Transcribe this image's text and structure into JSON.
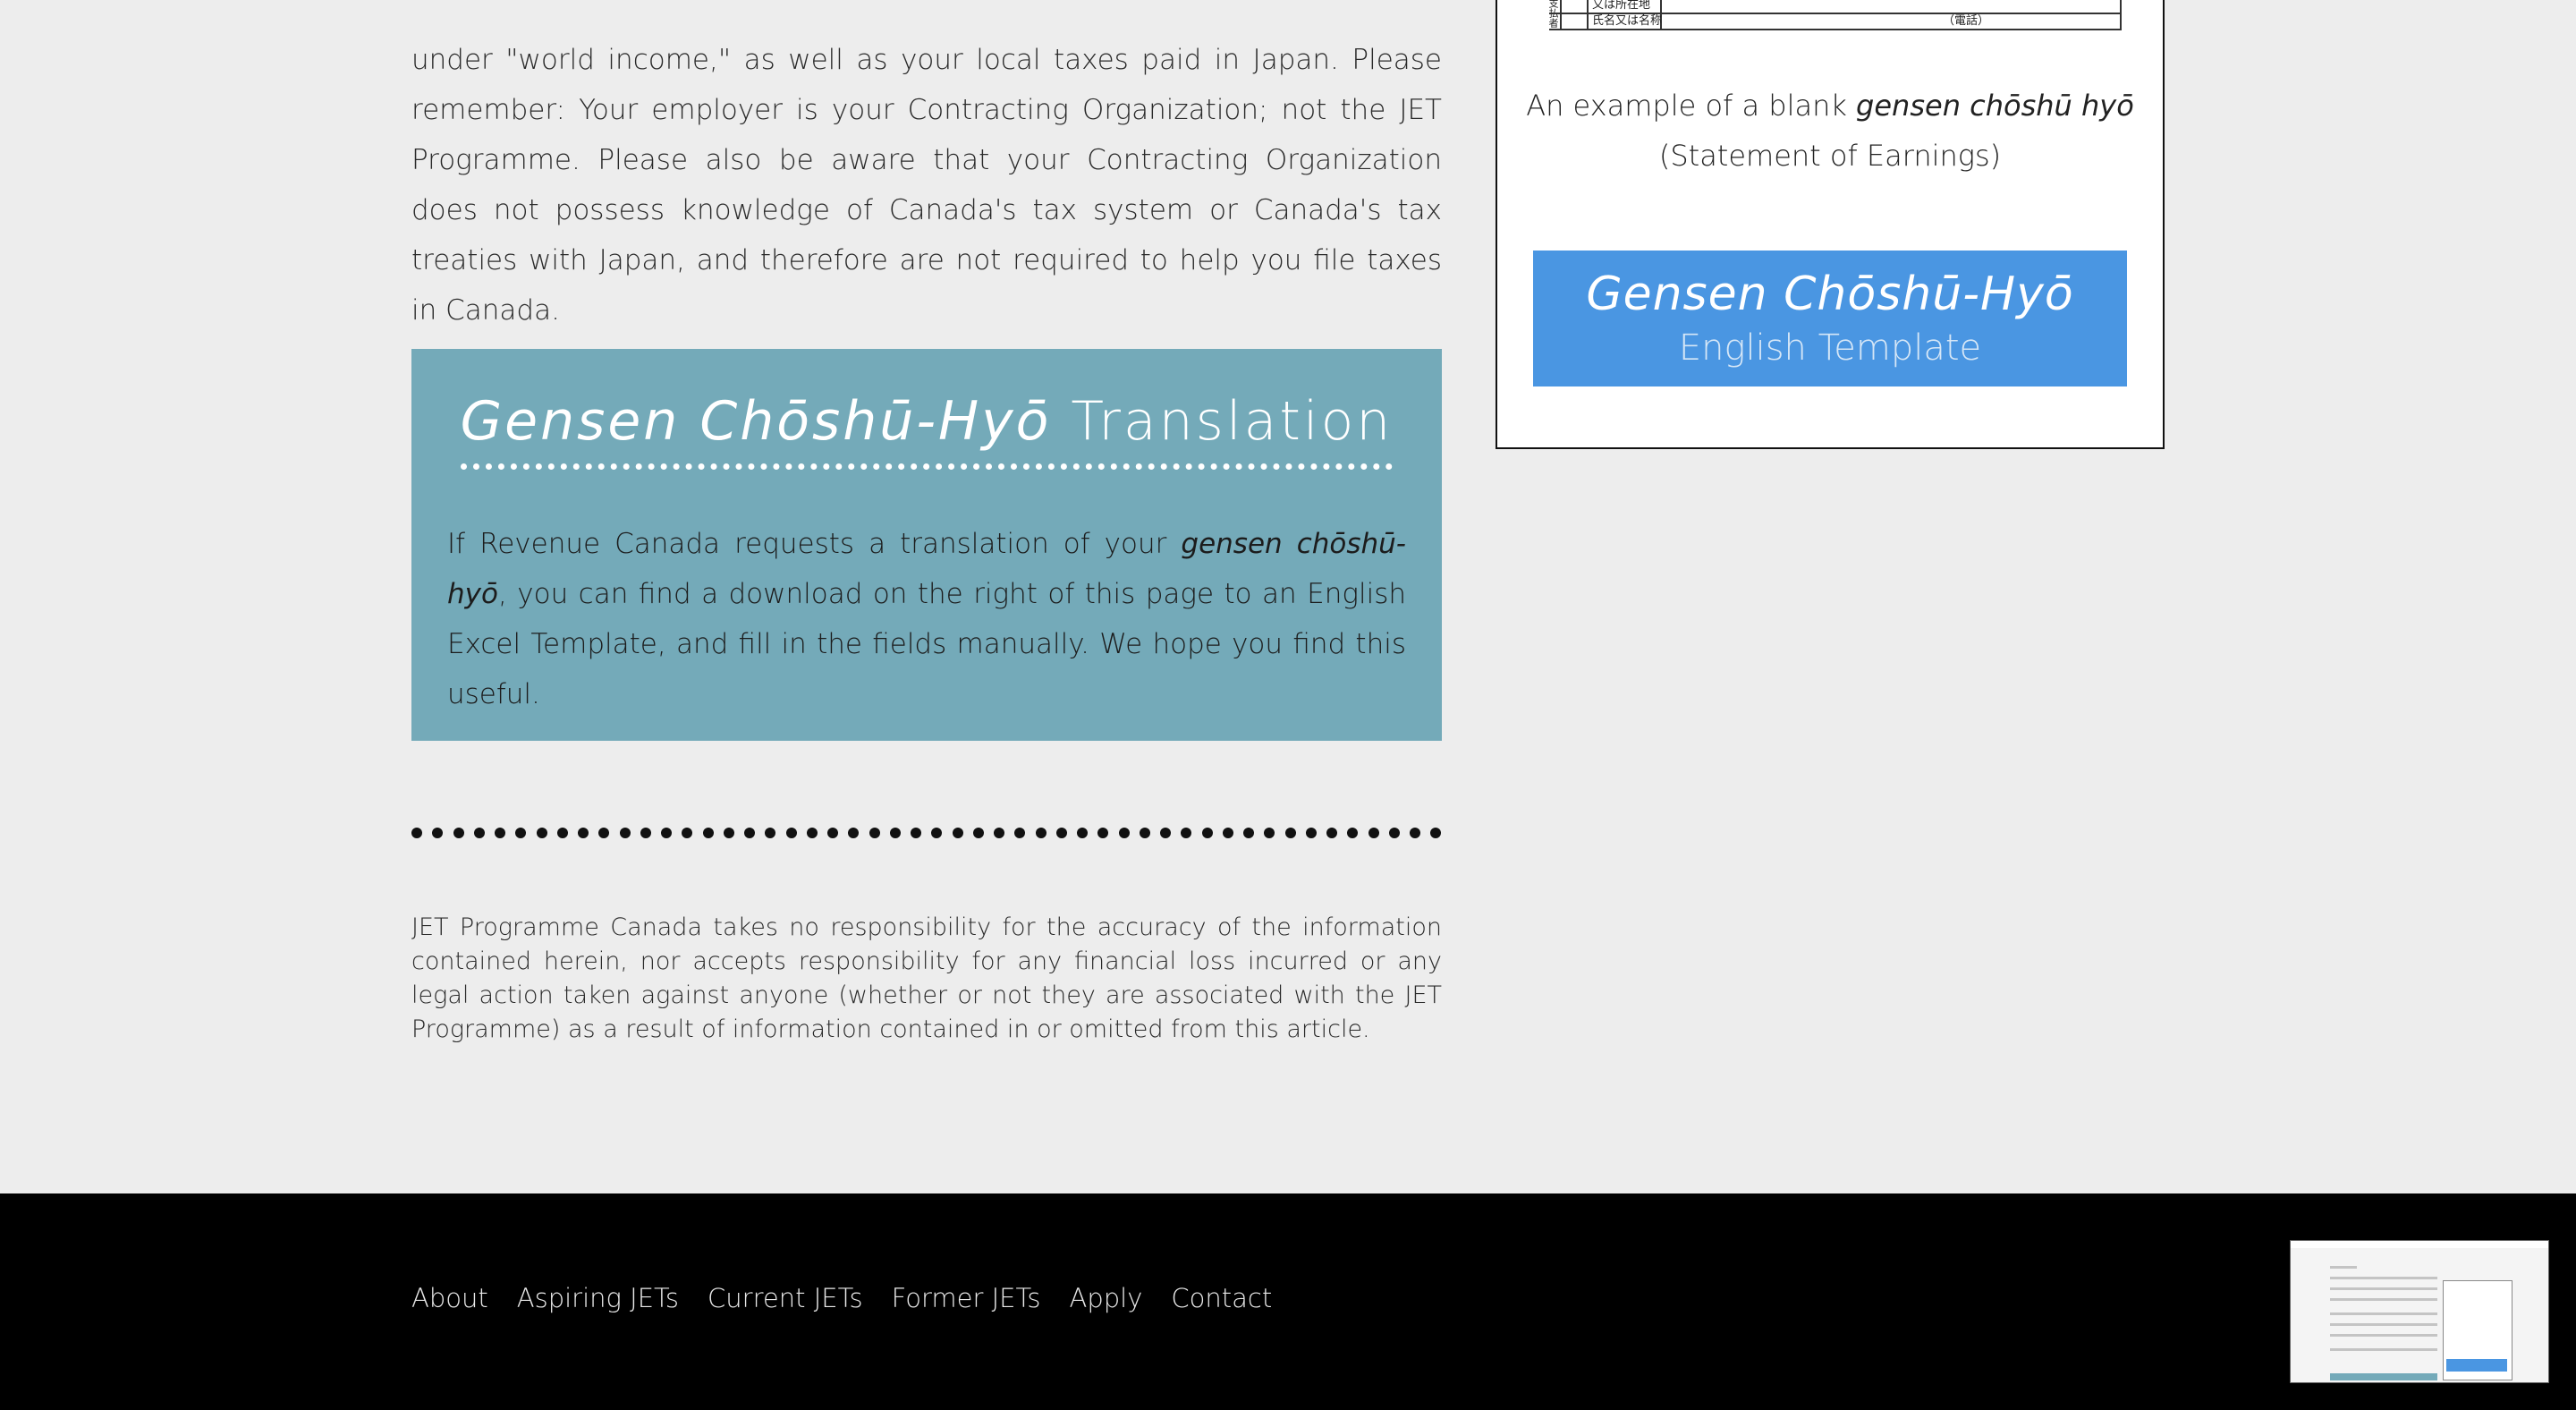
{
  "intro": {
    "paragraph": "under \"world income,\" as well as your local taxes paid in Japan. Please remember: Your employer is your Contracting Organization; not the JET Programme.  Please also be aware that your Contracting Organization does not possess knowledge of Canada's tax system or Canada's tax treaties with Japan, and therefore are not required to help you file taxes in Canada."
  },
  "translation": {
    "title_italic": "Gensen Chōshū-Hyō",
    "title_rest": " Translation",
    "body_before": "If Revenue Canada requests a translation of your ",
    "body_italic": "gensen chōshū-hyō",
    "body_after": ", you can find a download on the right of this page to an English Excel Template, and fill in the fields manually. We hope you find this useful."
  },
  "disclaimer": {
    "text": "JET Programme Canada takes no responsibility for the accuracy of the information contained herein, nor accepts responsibility for any financial loss incurred or any legal action taken against anyone (whether or not they are associated with the JET Programme) as a result of information contained in or omitted from this article."
  },
  "sidebar": {
    "form_row_1": "又は所在地",
    "form_row_2": "氏名又は名称",
    "form_row_2_note": "（電話）",
    "form_side_label": "支払者",
    "caption_before": "An example of a blank ",
    "caption_italic": "gensen chōshū hyō",
    "caption_after": "(Statement of Earnings)",
    "button_title": "Gensen Chōshū-Hyō",
    "button_subtitle": "English Template"
  },
  "footer": {
    "nav": [
      "About",
      "Aspiring JETs",
      "Current JETs",
      "Former JETs",
      "Apply",
      "Contact"
    ]
  },
  "colors": {
    "translation_bg": "#74aab9",
    "button_bg": "#4a96e2",
    "footer_bg": "#000000",
    "page_bg": "#ededed"
  }
}
